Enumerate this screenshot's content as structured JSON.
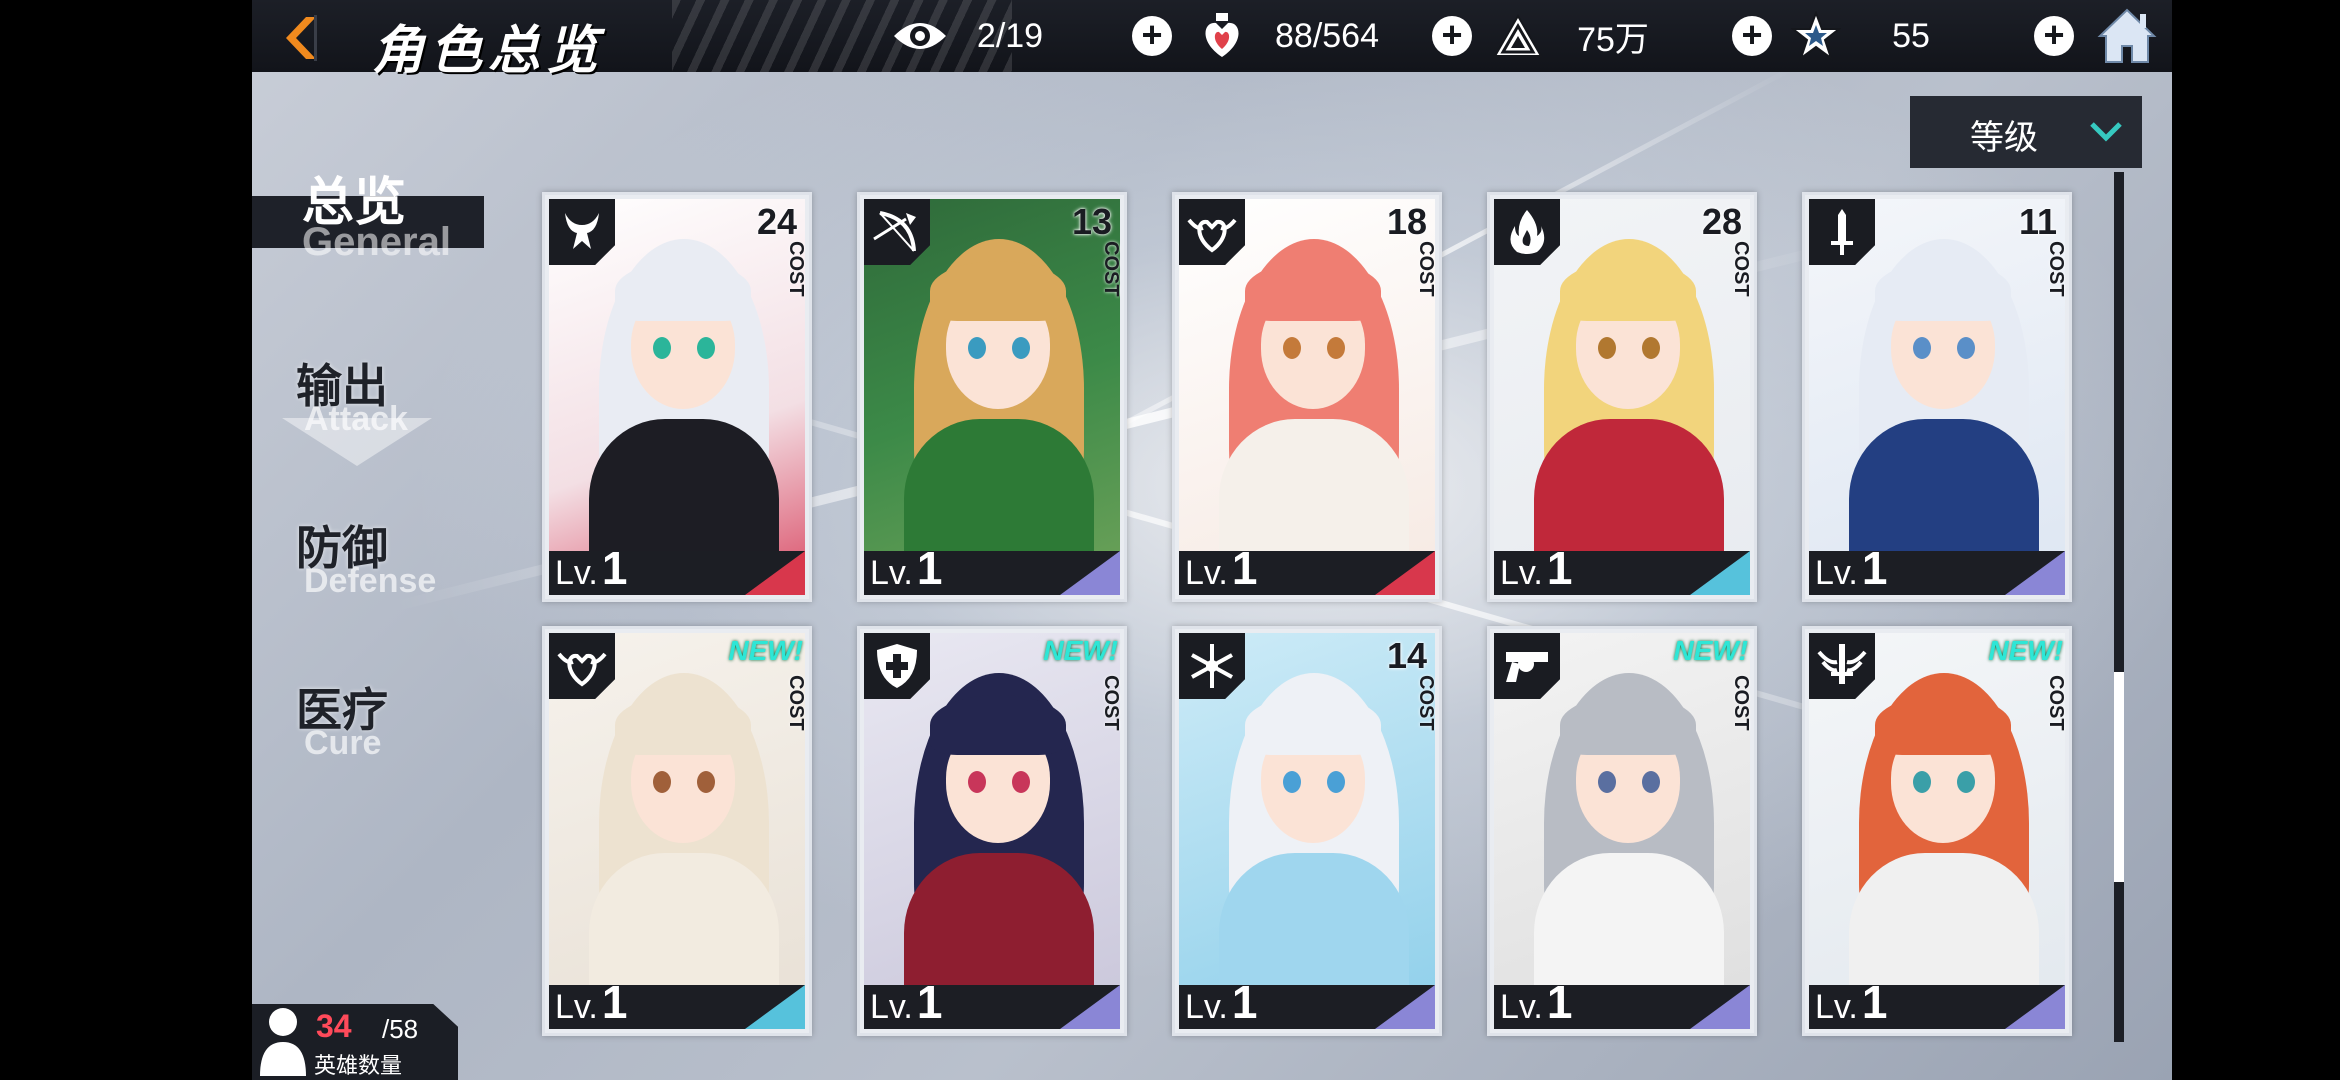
{
  "header": {
    "title": "角色总览",
    "resources": [
      {
        "icon": "eye-icon",
        "value": "2/19"
      },
      {
        "icon": "heart-potion-icon",
        "value": "88/564"
      },
      {
        "icon": "triangle-crystal-icon",
        "value": "75万"
      },
      {
        "icon": "star-shard-icon",
        "value": "55"
      }
    ]
  },
  "sort": {
    "label": "等级"
  },
  "categories": [
    {
      "label": "总览",
      "en": "General",
      "active": true
    },
    {
      "label": "输出",
      "en": "Attack"
    },
    {
      "label": "防御",
      "en": "Defense"
    },
    {
      "label": "医疗",
      "en": "Cure"
    }
  ],
  "cost_label": "COST",
  "lv_prefix": "Lv.",
  "new_label": "NEW!",
  "cards": [
    {
      "cost": "24",
      "level": "1",
      "class_icon": "demon-horns-icon",
      "rarity_color": "#d8374c",
      "is_new": false
    },
    {
      "cost": "13",
      "level": "1",
      "class_icon": "bow-icon",
      "rarity_color": "#8a86d6",
      "is_new": false
    },
    {
      "cost": "18",
      "level": "1",
      "class_icon": "winged-heart-icon",
      "rarity_color": "#d8374c",
      "is_new": false
    },
    {
      "cost": "28",
      "level": "1",
      "class_icon": "flame-icon",
      "rarity_color": "#56c2dc",
      "is_new": false
    },
    {
      "cost": "11",
      "level": "1",
      "class_icon": "sword-icon",
      "rarity_color": "#8a86d6",
      "is_new": false
    },
    {
      "cost": "",
      "level": "1",
      "class_icon": "winged-heart-icon",
      "rarity_color": "#56c2dc",
      "is_new": true
    },
    {
      "cost": "",
      "level": "1",
      "class_icon": "shield-cross-icon",
      "rarity_color": "#8a86d6",
      "is_new": true
    },
    {
      "cost": "14",
      "level": "1",
      "class_icon": "snowflake-icon",
      "rarity_color": "#8a86d6",
      "is_new": false
    },
    {
      "cost": "",
      "level": "1",
      "class_icon": "revolver-icon",
      "rarity_color": "#8a86d6",
      "is_new": true
    },
    {
      "cost": "",
      "level": "1",
      "class_icon": "winged-sword-icon",
      "rarity_color": "#8a86d6",
      "is_new": true
    }
  ],
  "hero_count": {
    "current": "34",
    "max": "/58",
    "label": "英雄数量"
  }
}
